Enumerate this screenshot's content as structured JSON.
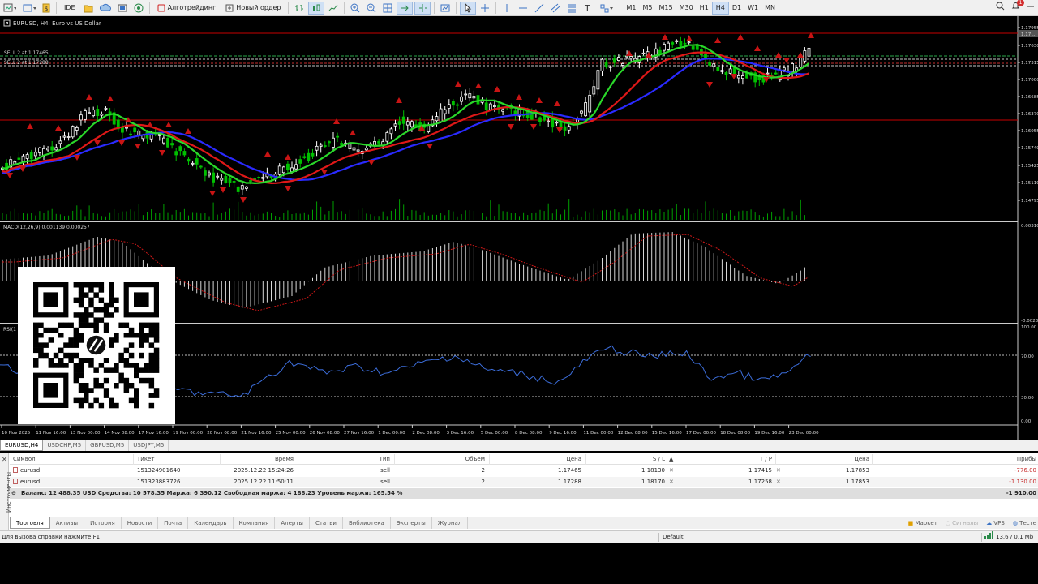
{
  "toolbar": {
    "ide": "IDE",
    "algo": "Алготрейдинг",
    "new_order": "Новый ордер",
    "timeframes": [
      "M1",
      "M5",
      "M15",
      "M30",
      "H1",
      "H4",
      "D1",
      "W1",
      "MN"
    ],
    "active_timeframe": "H4",
    "notif_count": "1"
  },
  "chart": {
    "title": "EURUSD, H4:  Euro vs US Dollar",
    "line1": "SELL 2 at 1.17465",
    "line2": "SELL 2 at 1.17288",
    "macd_label": "MACD(12,26,9) 0.001139 0.000257",
    "rsi_label": "RSI(1",
    "price_ticks": [
      "1.17955",
      "1.17630",
      "1.17315",
      "1.17000",
      "1.16685",
      "1.16370",
      "1.16055",
      "1.15740",
      "1.15425",
      "1.15110",
      "1.14795"
    ],
    "current_price": "1.17 ...",
    "macd_ticks": [
      "0.003100",
      "-0.0023"
    ],
    "rsi_ticks": [
      "100.00",
      "70.00",
      "30.00",
      "0.00"
    ],
    "time_ticks": [
      "10 Nov 2025",
      "11 Nov 16:00",
      "13 Nov 00:00",
      "14 Nov 08:00",
      "17 Nov 16:00",
      "19 Nov 00:00",
      "20 Nov 08:00",
      "21 Nov 16:00",
      "25 Nov 00:00",
      "26 Nov 08:00",
      "27 Nov 16:00",
      "1 Dec 00:00",
      "2 Dec 08:00",
      "3 Dec 16:00",
      "5 Dec 00:00",
      "8 Dec 08:00",
      "9 Dec 16:00",
      "11 Dec 00:00",
      "12 Dec 08:00",
      "15 Dec 16:00",
      "17 Dec 00:00",
      "18 Dec 08:00",
      "19 Dec 16:00",
      "23 Dec 00:00"
    ],
    "colors": {
      "sma_fast": "#2ad82a",
      "sma_mid": "#e01818",
      "sma_slow": "#2a2aff",
      "bull": "#ffffff",
      "bear": "#00c000",
      "arrow": "#c81414",
      "hline": "#c80000",
      "rsi": "#3c6edc",
      "volume": "#00a000"
    }
  },
  "chart_tabs": [
    "EURUSD,H4",
    "USDCHF,M5",
    "GBPUSD,M5",
    "USDJPY,M5"
  ],
  "chart_tab_active": "EURUSD,H4",
  "terminal": {
    "side_tab": "Инструменты",
    "headers": {
      "symbol": "Символ",
      "ticket": "Тикет",
      "time": "Время",
      "type": "Тип",
      "volume": "Объем",
      "price": "Цена",
      "sl": "S / L",
      "tp": "T / P",
      "cur_price": "Цена",
      "profit": "Прибы"
    },
    "rows": [
      {
        "symbol": "eurusd",
        "ticket": "151324901640",
        "time": "2025.12.22 15:24:26",
        "type": "sell",
        "volume": "2",
        "price": "1.17465",
        "sl": "1.18130",
        "tp": "1.17415",
        "cur_price": "1.17853",
        "profit": "-776.00"
      },
      {
        "symbol": "eurusd",
        "ticket": "151323883726",
        "time": "2025.12.22 11:50:11",
        "type": "sell",
        "volume": "2",
        "price": "1.17288",
        "sl": "1.18170",
        "tp": "1.17258",
        "cur_price": "1.17853",
        "profit": "-1 130.00"
      }
    ],
    "balance_line": "Баланс: 12 488.35 USD  Средства: 10 578.35  Маржа: 6 390.12  Свободная маржа: 4 188.23  Уровень маржи: 165.54 %",
    "total_profit": "-1 910.00",
    "bottom_tabs": [
      "Торговля",
      "Активы",
      "История",
      "Новости",
      "Почта",
      "Календарь",
      "Компания",
      "Алерты",
      "Статьи",
      "Библиотека",
      "Эксперты",
      "Журнал"
    ],
    "active_tab": "Торговля",
    "right_tabs": [
      "Маркет",
      "Сигналы",
      "VPS",
      "Тесте"
    ]
  },
  "status": {
    "help": "Для вызова справки нажмите F1",
    "profile": "Default",
    "net": "13.6 / 0.1 Mb"
  }
}
